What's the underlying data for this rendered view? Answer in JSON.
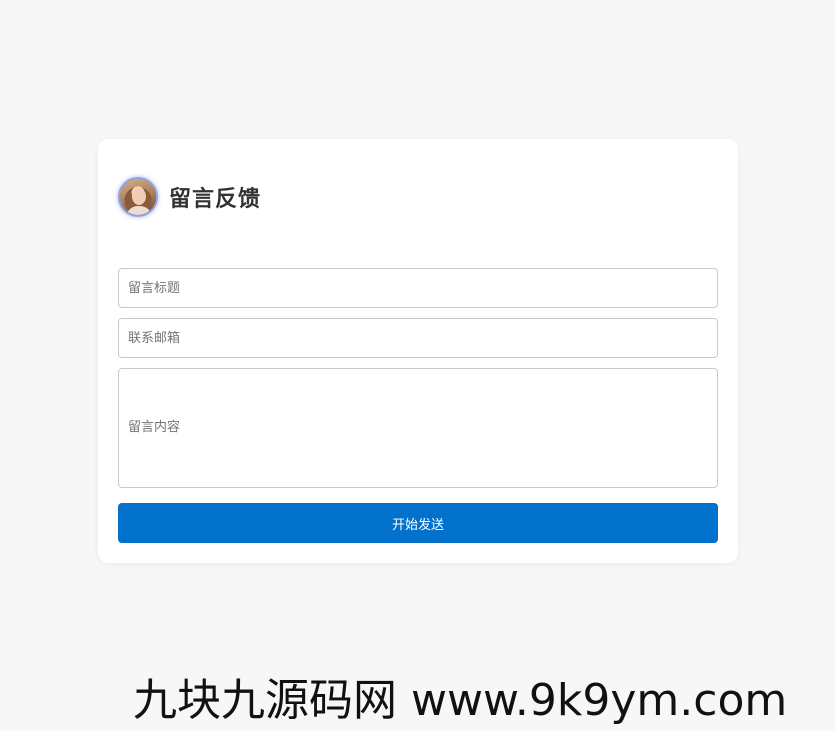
{
  "form": {
    "title": "留言反馈",
    "avatar_icon": "user-avatar",
    "fields": {
      "title_placeholder": "留言标题",
      "email_placeholder": "联系邮箱",
      "content_placeholder": "留言内容"
    },
    "submit_label": "开始发送",
    "accent_color": "#0271cc"
  },
  "watermark": {
    "text": "九块九源码网 www.9k9ym.com"
  }
}
